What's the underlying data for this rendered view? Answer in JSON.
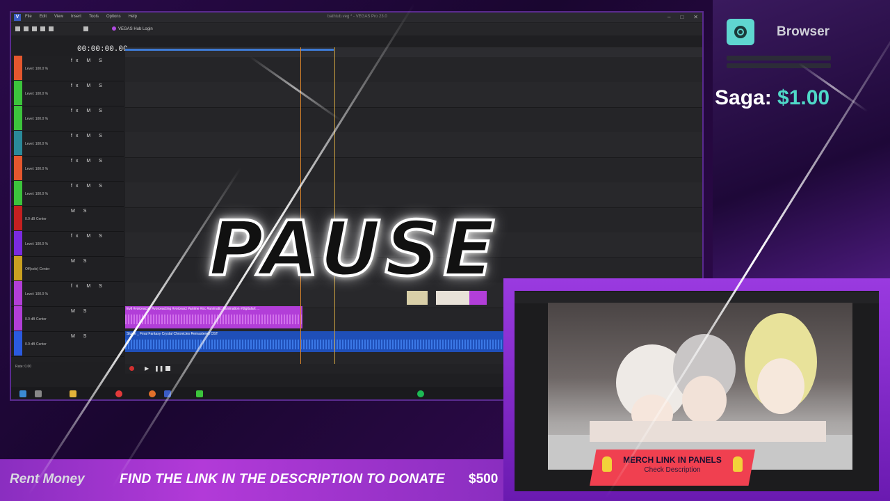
{
  "overlay": {
    "pause_text": "PAUSE",
    "browser_label": "Browser",
    "saga_label": "Saga:",
    "saga_amount": "$1.00",
    "bottom_left": "Rent Money",
    "donate_text": "FIND THE LINK IN THE DESCRIPTION TO DONATE",
    "donate_amount": "$500",
    "merch_title": "MERCH LINK IN PANELS",
    "merch_subtitle": "Check Description"
  },
  "vegas": {
    "window_title": "bathtub.veg * - VEGAS Pro 23.0",
    "menu": [
      "File",
      "Edit",
      "View",
      "Insert",
      "Tools",
      "Options",
      "Help"
    ],
    "hub_login": "VEGAS Hub Login",
    "timecode": "00:00:00.00",
    "rate": "Rate: 0.00",
    "tracks": [
      {
        "level": "Level: 100.0 %",
        "color": "#e4572e",
        "controls": "fx M S"
      },
      {
        "level": "Level: 100.0 %",
        "color": "#3cc43c",
        "controls": "fx M S"
      },
      {
        "level": "Level: 100.0 %",
        "color": "#3cc43c",
        "controls": "fx M S"
      },
      {
        "level": "Level: 100.0 %",
        "color": "#2a8a9a",
        "controls": "fx M S"
      },
      {
        "level": "Level: 100.0 %",
        "color": "#e4572e",
        "controls": "fx M S"
      },
      {
        "level": "Level: 100.0 %",
        "color": "#3cc43c",
        "controls": "fx M S"
      },
      {
        "level": "0.0 dB    Center",
        "color": "#c42020",
        "controls": "M S"
      },
      {
        "level": "Level: 100.0 %",
        "color": "#7a2ae0",
        "controls": "fx M S"
      },
      {
        "level": "Off(solo)    Center",
        "color": "#c9a020",
        "controls": "M S"
      },
      {
        "level": "Level: 100.0 %",
        "color": "#b23ed8",
        "controls": "fx M S"
      },
      {
        "level": "0.0 dB    Center",
        "color": "#b23ed8",
        "controls": "M S"
      },
      {
        "level": "0.0 dB    Center",
        "color": "#2a5ae0",
        "controls": "M S"
      }
    ],
    "clip_purple": "Evil #voiceactor #voiceacting #voiceact #anime #oc #animatic #animation #digitalart ...",
    "clip_blue": "Sluice _ Final Fantasy Crystal Chronicles Remastered OST"
  },
  "colors": {
    "accent": "#b23ad8",
    "teal": "#4fd8c8",
    "merch": "#f04050"
  }
}
